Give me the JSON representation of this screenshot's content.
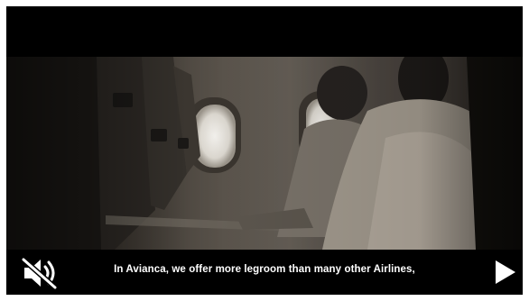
{
  "video": {
    "caption": "In Avianca, we offer more legroom than many other Airlines,",
    "muted": true,
    "playing": false
  },
  "icons": {
    "mute": "speaker-muted-icon",
    "play": "play-icon"
  },
  "colors": {
    "background": "#000000",
    "caption_text": "#ffffff",
    "icon": "#ffffff"
  }
}
